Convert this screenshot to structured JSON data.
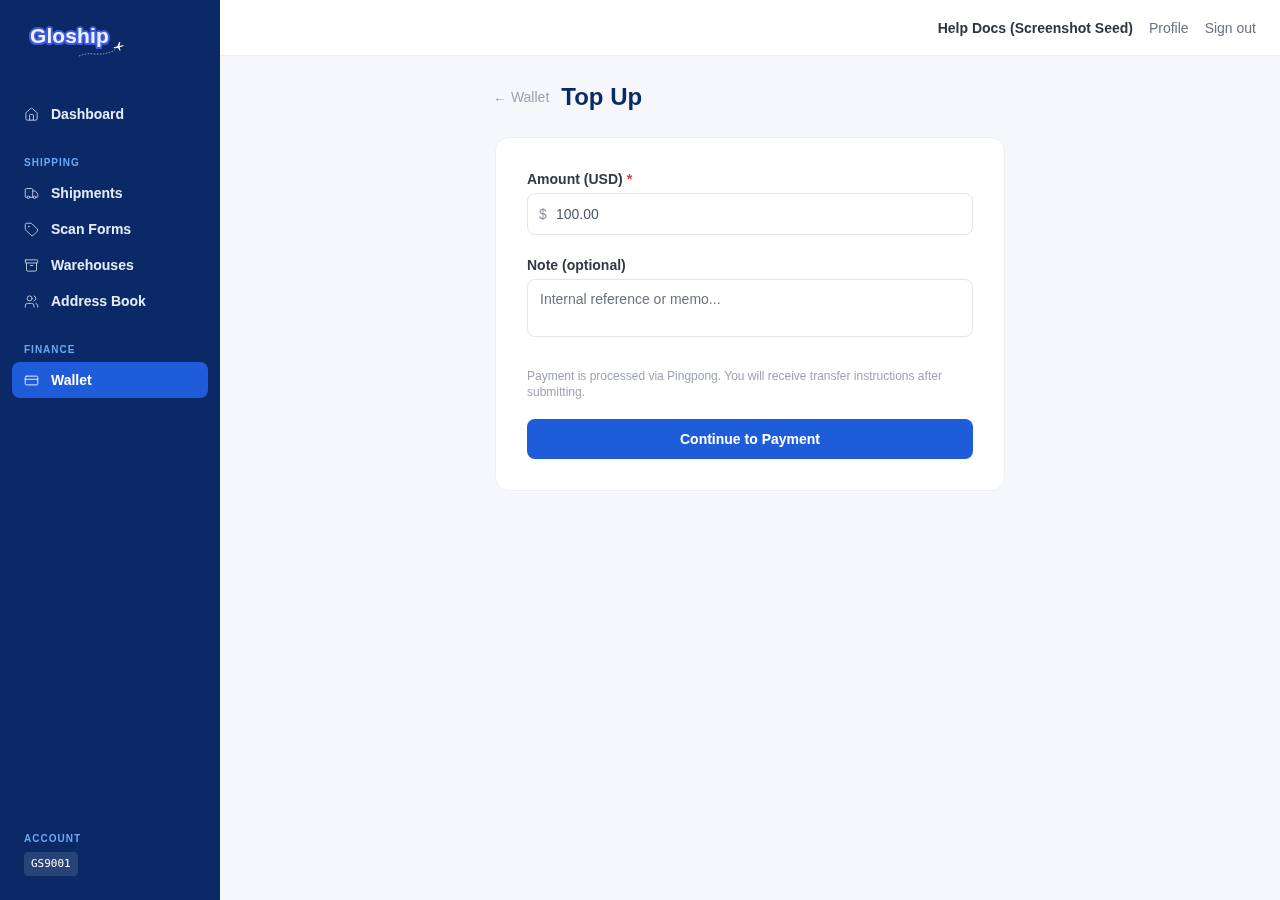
{
  "brand": {
    "name": "Gloship"
  },
  "sidebar": {
    "sections": [
      {
        "items": [
          {
            "label": "Dashboard",
            "selected": false
          }
        ]
      },
      {
        "title": "SHIPPING",
        "items": [
          {
            "label": "Shipments",
            "selected": false
          },
          {
            "label": "Scan Forms",
            "selected": false
          },
          {
            "label": "Warehouses",
            "selected": false
          },
          {
            "label": "Address Book",
            "selected": false
          }
        ]
      },
      {
        "title": "FINANCE",
        "items": [
          {
            "label": "Wallet",
            "selected": true
          }
        ]
      }
    ],
    "account": {
      "title": "ACCOUNT",
      "code": "GS9001"
    }
  },
  "header": {
    "links": [
      {
        "label": "Help Docs (Screenshot Seed)",
        "kind": "primary"
      },
      {
        "label": "Profile",
        "kind": "plain"
      },
      {
        "label": "Sign out",
        "kind": "plain"
      }
    ]
  },
  "page": {
    "back_link": "← Wallet",
    "title": "Top Up"
  },
  "form": {
    "fields": [
      {
        "kind": "amount",
        "label": "Amount (USD)",
        "required_mark": "*",
        "prefix": "$",
        "value": "100.00"
      },
      {
        "kind": "textarea",
        "label": "Note (optional)",
        "placeholder": "Internal reference or memo..."
      }
    ],
    "note": "Payment is processed via Pingpong. You will receive transfer instructions after submitting.",
    "submit": "Continue to Payment"
  }
}
